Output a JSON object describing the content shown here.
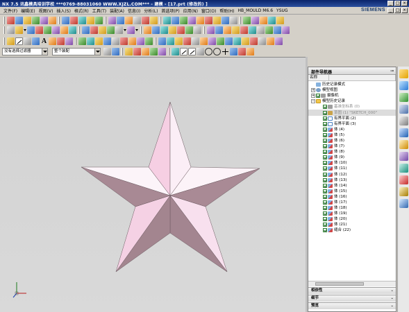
{
  "window": {
    "title": "NX 7.5 讯鑫模具培训学校   ***0769-88031060   WWW.XJZL.COM***  - 建模 - [17.prt  (修改的) ]",
    "min": "_",
    "max": "□",
    "close": "×"
  },
  "menu": {
    "items": [
      "文件(F)",
      "编辑(E)",
      "视图(V)",
      "插入(S)",
      "格式(R)",
      "工具(T)",
      "装配(A)",
      "信息(I)",
      "分析(L)",
      "首选项(P)",
      "应用(N)",
      "窗口(O)",
      "帮助(H)",
      "HB_MOULD M6.6",
      "YSUG"
    ],
    "brand": "SIEMENS"
  },
  "toolbar": {
    "filter_combo": "没有选择过滤器",
    "assembly_combo": "整个装配"
  },
  "navigator": {
    "title": "部件导航器",
    "col_name": "名称",
    "items": [
      {
        "label": "历史记录模式",
        "icon": "hist",
        "indent": 1,
        "exp": "",
        "chk": false
      },
      {
        "label": "模型视图",
        "icon": "eye",
        "indent": 1,
        "exp": "+",
        "chk": false
      },
      {
        "label": "摄像机",
        "icon": "csys",
        "indent": 1,
        "exp": "+",
        "chk": true
      },
      {
        "label": "模型历史记录",
        "icon": "folder",
        "indent": 1,
        "exp": "−",
        "chk": false
      },
      {
        "label": "基准坐标系 (0)",
        "icon": "csys",
        "indent": 2,
        "exp": "",
        "chk": true,
        "grey": true
      },
      {
        "label": "草图 (1) \"SKETCH_000\"",
        "icon": "sketch",
        "indent": 2,
        "exp": "",
        "chk": true,
        "grey": true,
        "sel": true
      },
      {
        "label": "有界平面 (2)",
        "icon": "plane",
        "indent": 2,
        "exp": "",
        "chk": true
      },
      {
        "label": "有界平面 (3)",
        "icon": "plane",
        "indent": 2,
        "exp": "",
        "chk": true
      },
      {
        "label": "体 (4)",
        "icon": "body",
        "indent": 2,
        "exp": "",
        "chk": true
      },
      {
        "label": "体 (5)",
        "icon": "body",
        "indent": 2,
        "exp": "",
        "chk": true
      },
      {
        "label": "体 (6)",
        "icon": "body",
        "indent": 2,
        "exp": "",
        "chk": true
      },
      {
        "label": "体 (7)",
        "icon": "body",
        "indent": 2,
        "exp": "",
        "chk": true
      },
      {
        "label": "体 (8)",
        "icon": "body",
        "indent": 2,
        "exp": "",
        "chk": true
      },
      {
        "label": "体 (9)",
        "icon": "body",
        "indent": 2,
        "exp": "",
        "chk": true
      },
      {
        "label": "体 (10)",
        "icon": "body",
        "indent": 2,
        "exp": "",
        "chk": true
      },
      {
        "label": "体 (11)",
        "icon": "body",
        "indent": 2,
        "exp": "",
        "chk": true
      },
      {
        "label": "体 (12)",
        "icon": "body",
        "indent": 2,
        "exp": "",
        "chk": true
      },
      {
        "label": "体 (13)",
        "icon": "body",
        "indent": 2,
        "exp": "",
        "chk": true
      },
      {
        "label": "体 (14)",
        "icon": "body",
        "indent": 2,
        "exp": "",
        "chk": true
      },
      {
        "label": "体 (15)",
        "icon": "body",
        "indent": 2,
        "exp": "",
        "chk": true
      },
      {
        "label": "体 (16)",
        "icon": "body",
        "indent": 2,
        "exp": "",
        "chk": true
      },
      {
        "label": "体 (17)",
        "icon": "body",
        "indent": 2,
        "exp": "",
        "chk": true
      },
      {
        "label": "体 (18)",
        "icon": "body",
        "indent": 2,
        "exp": "",
        "chk": true
      },
      {
        "label": "体 (19)",
        "icon": "body",
        "indent": 2,
        "exp": "",
        "chk": true
      },
      {
        "label": "体 (20)",
        "icon": "body",
        "indent": 2,
        "exp": "",
        "chk": true
      },
      {
        "label": "体 (21)",
        "icon": "body",
        "indent": 2,
        "exp": "",
        "chk": true
      },
      {
        "label": "缝合 (22)",
        "icon": "body",
        "indent": 2,
        "exp": "",
        "chk": true
      }
    ],
    "sections": [
      {
        "label": "相依性"
      },
      {
        "label": "细节"
      },
      {
        "label": "预览"
      }
    ]
  },
  "colors": {
    "star_light": "#f7d3e6",
    "star_white": "#fbf1f7",
    "star_dark": "#a58790",
    "star_mid": "#c6a6b6",
    "viewport_bg": "#d6d6d6"
  }
}
